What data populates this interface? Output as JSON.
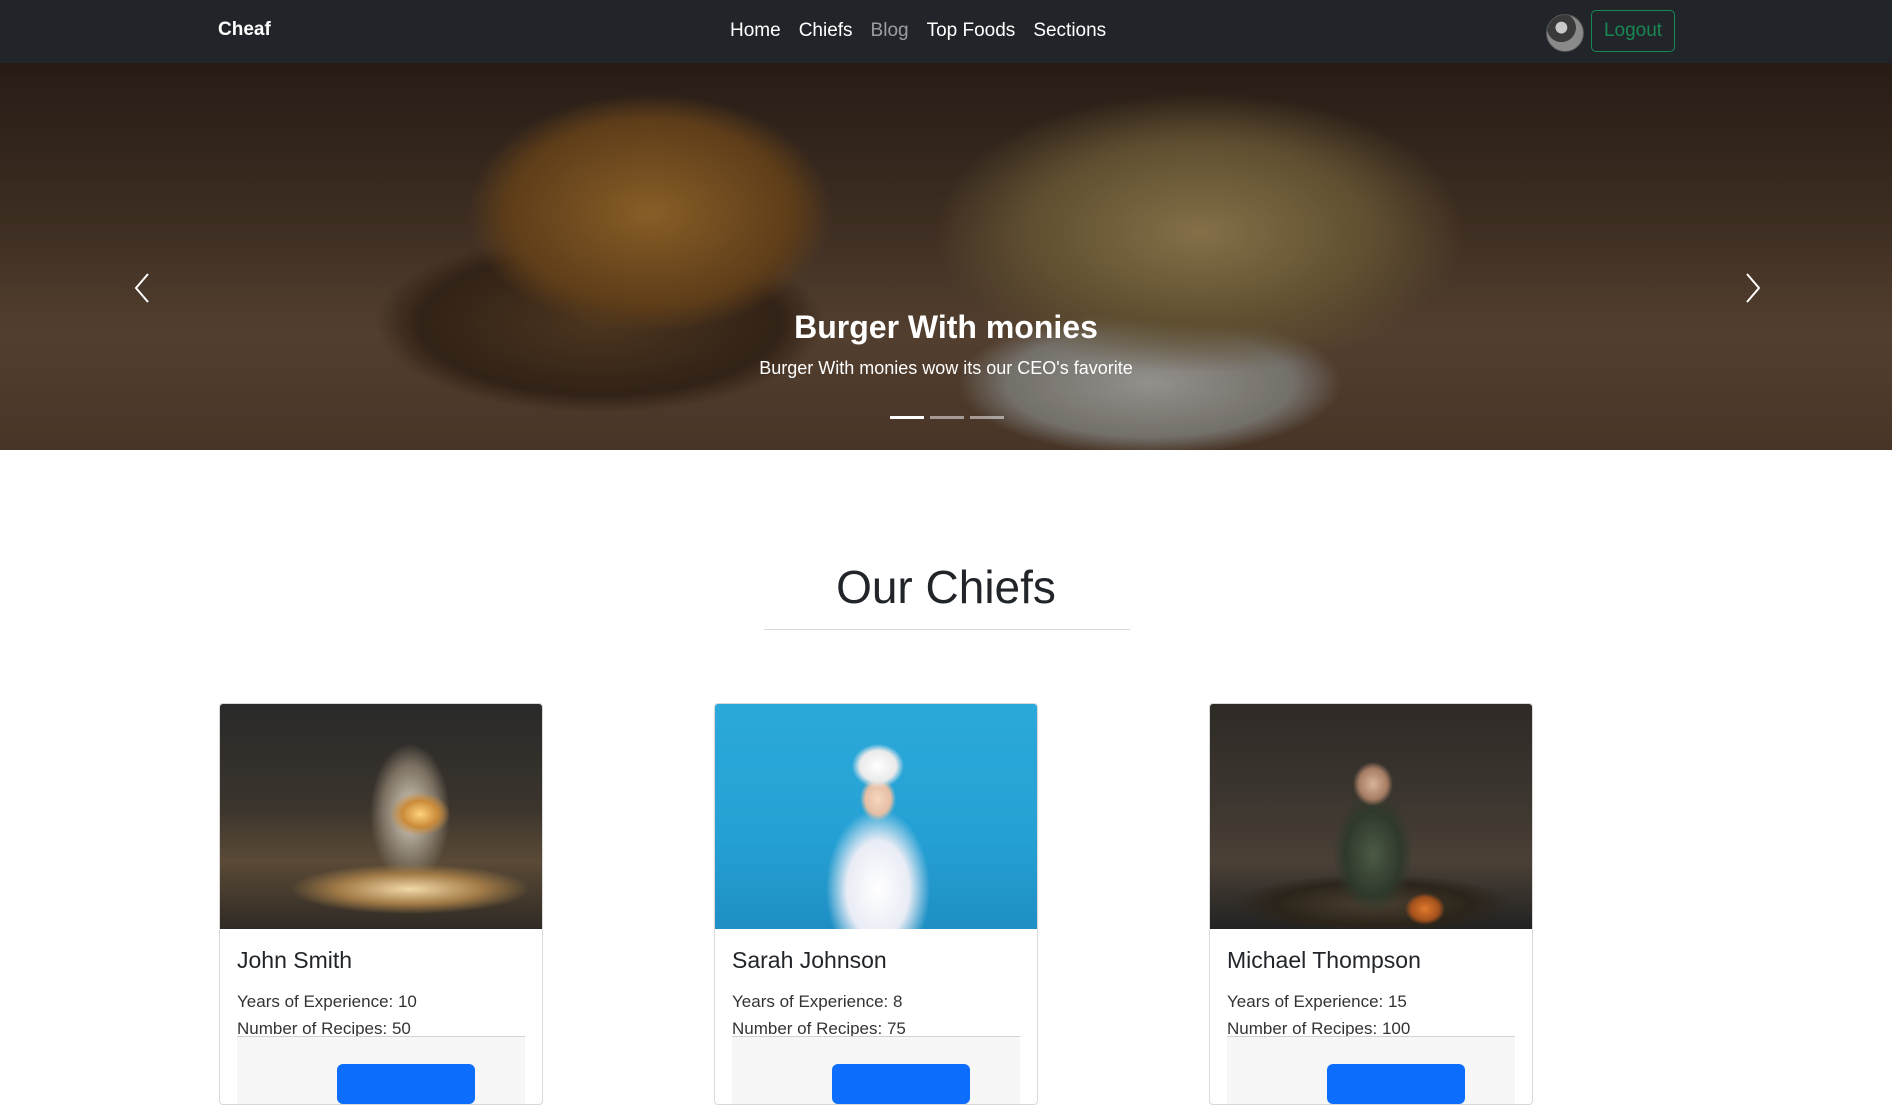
{
  "navbar": {
    "brand": "Cheaf",
    "links": [
      "Home",
      "Chiefs",
      "Blog",
      "Top Foods",
      "Sections"
    ],
    "logout_label": "Logout"
  },
  "hero": {
    "title": "Burger With monies",
    "text": "Burger With monies wow its our CEO's favorite",
    "slides_total": 3,
    "active_slide": 1
  },
  "chiefs_section": {
    "title": "Our Chiefs",
    "cards": [
      {
        "name": "John Smith",
        "experience": "Years of Experience: 10",
        "recipes": "Number of Recipes: 50"
      },
      {
        "name": "Sarah Johnson",
        "experience": "Years of Experience: 8",
        "recipes": "Number of Recipes: 75"
      },
      {
        "name": "Michael Thompson",
        "experience": "Years of Experience: 15",
        "recipes": "Number of Recipes: 100"
      }
    ]
  },
  "colors": {
    "navbar_bg": "#212529",
    "logout": "#198754",
    "primary_button": "#0d6efd"
  }
}
